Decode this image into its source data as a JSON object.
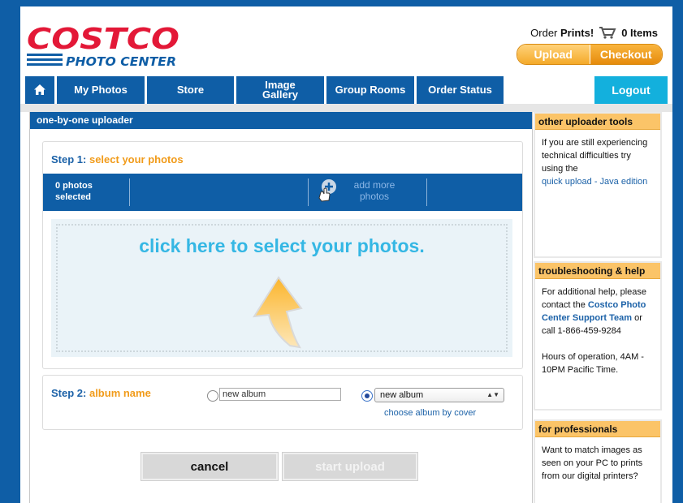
{
  "header": {
    "logo": {
      "brand": "COSTCO",
      "sub": "PHOTO CENTER",
      "colors": {
        "red": "#e31837",
        "blue": "#0f5ea6"
      }
    },
    "order_prints_label": "Order",
    "order_prints_bold": "Prints!",
    "cart_count": "0 Items",
    "upload_label": "Upload",
    "checkout_label": "Checkout"
  },
  "nav": {
    "home_icon": "home-icon",
    "tabs": [
      {
        "label": "My Photos"
      },
      {
        "label": "Store"
      },
      {
        "label": "Image Gallery"
      },
      {
        "label": "Group Rooms"
      },
      {
        "label": "Order Status"
      }
    ],
    "logout_label": "Logout"
  },
  "uploader": {
    "title": "one-by-one uploader",
    "step1_prefix": "Step 1:",
    "step1_label": "select your photos",
    "photos_count": "0 photos",
    "photos_selected": "selected",
    "add_more_line1": "add more",
    "add_more_line2": "photos",
    "drop_message": "click here to select your photos.",
    "step2_prefix": "Step 2:",
    "step2_label": "album name",
    "new_album_input_value": "new album",
    "album_select_value": "new album",
    "choose_by_cover": "choose album by cover",
    "cancel_label": "cancel",
    "start_upload_label": "start upload"
  },
  "sidebar": {
    "tools": {
      "title": "other uploader tools",
      "text": "If you are still experiencing technical difficulties try using the",
      "link": "quick upload - Java edition"
    },
    "help": {
      "title": "troubleshooting & help",
      "text1": "For additional help, please contact the",
      "link": "Costco Photo Center Support Team",
      "text2": "or call 1-866-459-9284",
      "hours": "Hours of operation, 4AM - 10PM Pacific Time."
    },
    "pros": {
      "title": "for professionals",
      "text": "Want to match images as seen on your PC to prints from our digital printers?"
    }
  }
}
